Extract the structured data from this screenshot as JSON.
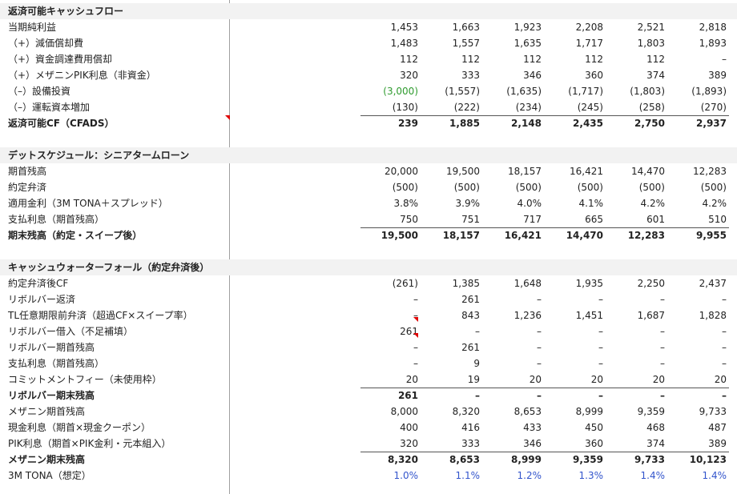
{
  "sections": [
    {
      "title": "返済可能キャッシュフロー",
      "rows": [
        {
          "label": "当期純利益",
          "values": [
            "1,453",
            "1,663",
            "1,923",
            "2,208",
            "2,521",
            "2,818"
          ]
        },
        {
          "label": "（+）減価償却費",
          "values": [
            "1,483",
            "1,557",
            "1,635",
            "1,717",
            "1,803",
            "1,893"
          ]
        },
        {
          "label": "（+）資金調達費用償却",
          "values": [
            "112",
            "112",
            "112",
            "112",
            "112",
            "–"
          ]
        },
        {
          "label": "（+）メザニンPIK利息（非資金）",
          "values": [
            "320",
            "333",
            "346",
            "360",
            "374",
            "389"
          ]
        },
        {
          "label": "（–）設備投資",
          "values": [
            "(3,000)",
            "(1,557)",
            "(1,635)",
            "(1,717)",
            "(1,803)",
            "(1,893)"
          ],
          "first_value_color": "#2e9b2e"
        },
        {
          "label": "（–）運転資本増加",
          "values": [
            "(130)",
            "(222)",
            "(234)",
            "(245)",
            "(258)",
            "(270)"
          ]
        },
        {
          "label": "返済可能CF（CFADS）",
          "values": [
            "239",
            "1,885",
            "2,148",
            "2,435",
            "2,750",
            "2,937"
          ],
          "bold": true
        }
      ]
    },
    {
      "title": "デットスケジュール：シニアタームローン",
      "rows": [
        {
          "label": "期首残高",
          "values": [
            "20,000",
            "19,500",
            "18,157",
            "16,421",
            "14,470",
            "12,283"
          ]
        },
        {
          "label": "約定弁済",
          "values": [
            "(500)",
            "(500)",
            "(500)",
            "(500)",
            "(500)",
            "(500)"
          ]
        },
        {
          "label": "適用金利（3M TONA＋スプレッド）",
          "values": [
            "3.8%",
            "3.9%",
            "4.0%",
            "4.1%",
            "4.2%",
            "4.2%"
          ]
        },
        {
          "label": "支払利息（期首残高）",
          "values": [
            "750",
            "751",
            "717",
            "665",
            "601",
            "510"
          ]
        },
        {
          "label": "期末残高（約定・スイープ後）",
          "values": [
            "19,500",
            "18,157",
            "16,421",
            "14,470",
            "12,283",
            "9,955"
          ],
          "bold": true
        }
      ]
    },
    {
      "title": "キャッシュウォーターフォール（約定弁済後）",
      "rows": [
        {
          "label": "約定弁済後CF",
          "values": [
            "(261)",
            "1,385",
            "1,648",
            "1,935",
            "2,250",
            "2,437"
          ]
        },
        {
          "label": "リボルバー返済",
          "values": [
            "–",
            "261",
            "–",
            "–",
            "–",
            "–"
          ]
        },
        {
          "label": "TL任意期限前弁済（超過CF×スイープ率）",
          "values": [
            "–",
            "843",
            "1,236",
            "1,451",
            "1,687",
            "1,828"
          ]
        },
        {
          "label": "リボルバー借入（不足補填）",
          "values": [
            "261",
            "–",
            "–",
            "–",
            "–",
            "–"
          ]
        },
        {
          "label": "リボルバー期首残高",
          "values": [
            "–",
            "261",
            "–",
            "–",
            "–",
            "–"
          ]
        },
        {
          "label": "支払利息（期首残高）",
          "values": [
            "–",
            "9",
            "–",
            "–",
            "–",
            "–"
          ]
        },
        {
          "label": "コミットメントフィー（未使用枠）",
          "values": [
            "20",
            "19",
            "20",
            "20",
            "20",
            "20"
          ]
        },
        {
          "label": "リボルバー期末残高",
          "values": [
            "261",
            "–",
            "–",
            "–",
            "–",
            "–"
          ],
          "bold": true
        },
        {
          "label": "メザニン期首残高",
          "values": [
            "8,000",
            "8,320",
            "8,653",
            "8,999",
            "9,359",
            "9,733"
          ]
        },
        {
          "label": "現金利息（期首×現金クーポン）",
          "values": [
            "400",
            "416",
            "433",
            "450",
            "468",
            "487"
          ]
        },
        {
          "label": "PIK利息（期首×PIK金利・元本組入）",
          "values": [
            "320",
            "333",
            "346",
            "360",
            "374",
            "389"
          ]
        },
        {
          "label": "メザニン期末残高",
          "values": [
            "8,320",
            "8,653",
            "8,999",
            "9,359",
            "9,733",
            "10,123"
          ],
          "bold": true
        },
        {
          "label": "3M TONA（想定）",
          "values": [
            "1.0%",
            "1.1%",
            "1.2%",
            "1.3%",
            "1.4%",
            "1.4%"
          ],
          "value_color": "#3355cc"
        }
      ]
    }
  ]
}
